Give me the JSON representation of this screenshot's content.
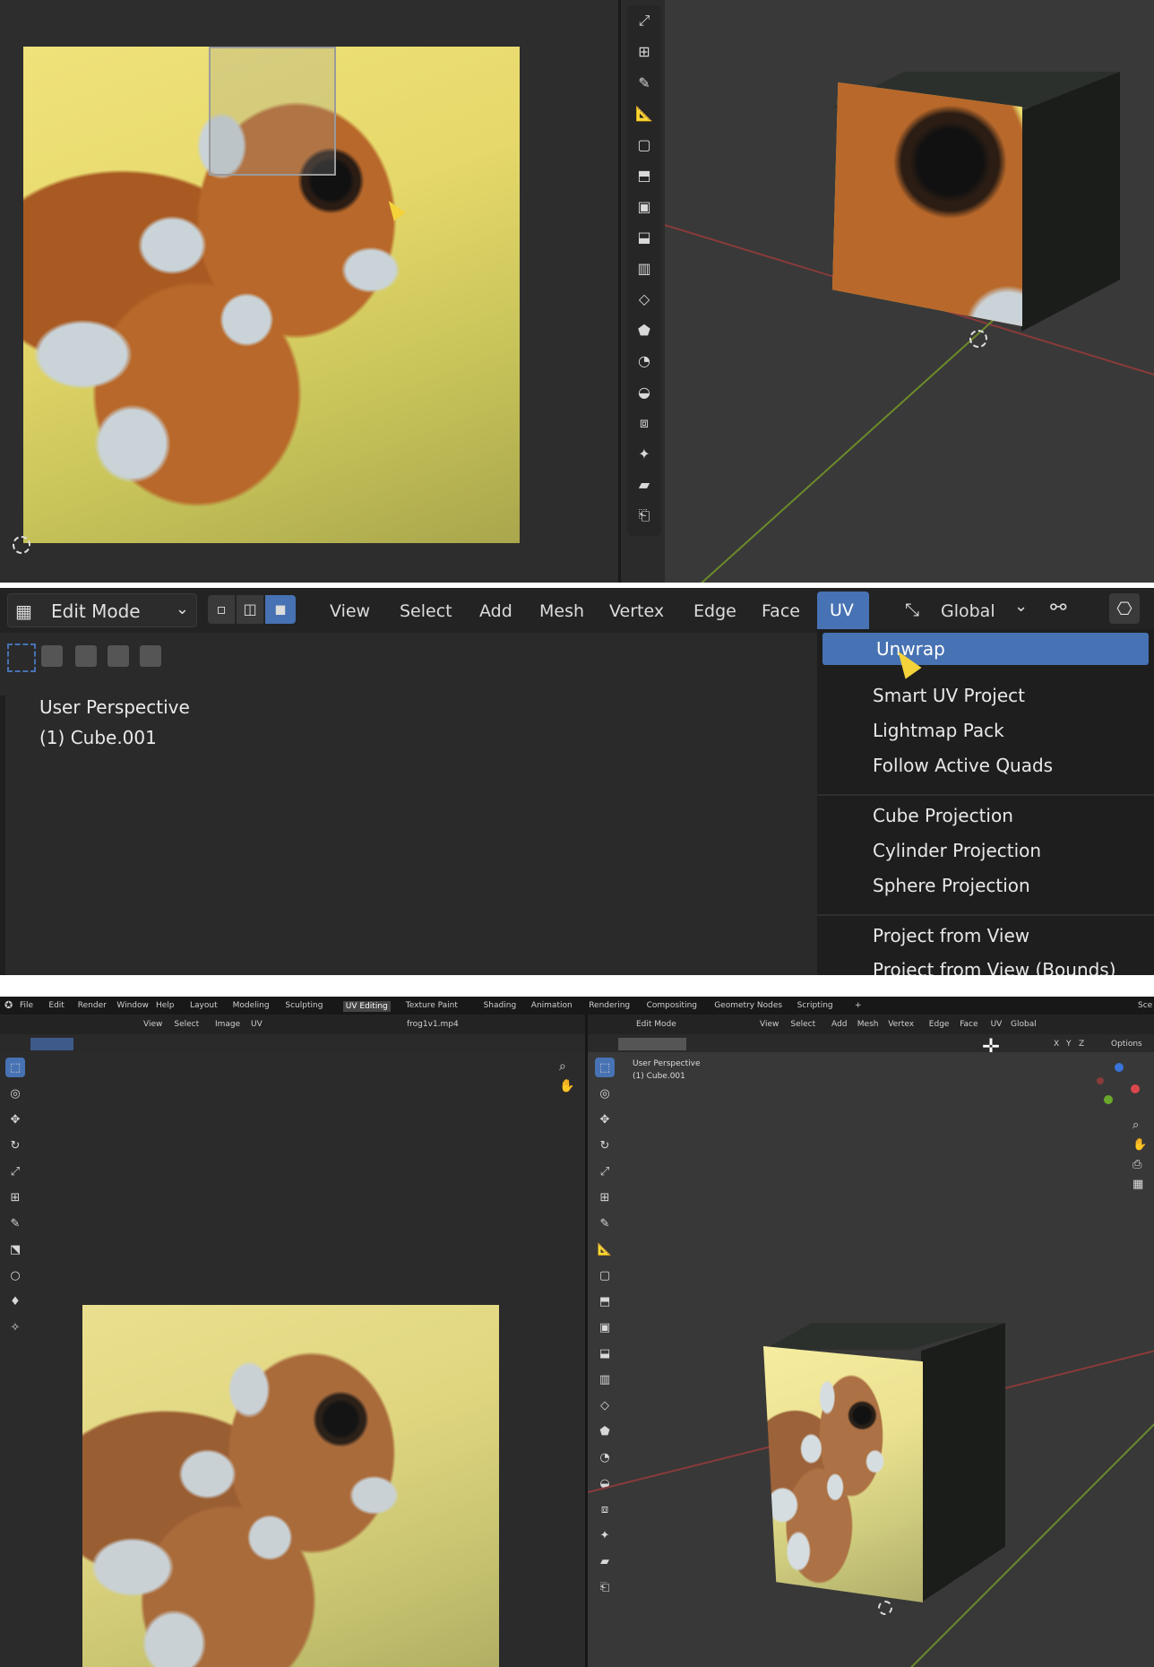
{
  "top": {
    "tools_3d": [
      "scale-icon",
      "transform-icon",
      "annotate-icon",
      "measure-icon",
      "add-cube-icon",
      "extrude-icon",
      "inset-icon",
      "bevel-icon",
      "loop-cut-icon",
      "knife-icon",
      "poly-build-icon",
      "spin-icon",
      "smooth-icon",
      "edge-slide-icon",
      "shrink-icon",
      "shear-icon",
      "rip-icon"
    ]
  },
  "middle": {
    "mode": "Edit Mode",
    "menu": [
      "View",
      "Select",
      "Add",
      "Mesh",
      "Vertex",
      "Edge",
      "Face",
      "UV"
    ],
    "active_menu": "UV",
    "transform_orientation": "Global",
    "viewport_info": {
      "line1": "User Perspective",
      "line2": "(1) Cube.001"
    },
    "uv_menu": {
      "items": [
        "Unwrap",
        "Smart UV Project",
        "Lightmap Pack",
        "Follow Active Quads",
        "Cube Projection",
        "Cylinder Projection",
        "Sphere Projection",
        "Project from View",
        "Project from View (Bounds)"
      ],
      "highlighted": "Unwrap"
    }
  },
  "bottom": {
    "topbar": {
      "menus": [
        "File",
        "Edit",
        "Render",
        "Window",
        "Help"
      ],
      "workspaces": [
        "Layout",
        "Modeling",
        "Sculpting",
        "UV Editing",
        "Texture Paint",
        "Shading",
        "Animation",
        "Rendering",
        "Compositing",
        "Geometry Nodes",
        "Scripting",
        "+"
      ],
      "active_workspace": "UV Editing",
      "scene": "Sce"
    },
    "uv_header": {
      "menus": [
        "View",
        "Select",
        "Image",
        "UV"
      ],
      "image_name": "frog1v1.mp4"
    },
    "vp_header": {
      "mode": "Edit Mode",
      "menus": [
        "View",
        "Select",
        "Add",
        "Mesh",
        "Vertex",
        "Edge",
        "Face",
        "UV"
      ],
      "orientation": "Global",
      "options": "Options",
      "axes": [
        "X",
        "Y",
        "Z"
      ]
    },
    "vp_info": {
      "line1": "User Perspective",
      "line2": "(1) Cube.001"
    },
    "uv_tools": [
      "select-icon",
      "cursor-icon",
      "move-icon",
      "rotate-icon",
      "scale-icon",
      "transform-icon",
      "annotate-icon",
      "rip-region-icon",
      "grab-icon",
      "pinch-icon",
      "relax-icon"
    ],
    "vp_tools": [
      "select-icon",
      "cursor-icon",
      "move-icon",
      "rotate-icon",
      "scale-icon",
      "transform-icon",
      "annotate-icon",
      "measure-icon",
      "add-cube-icon",
      "extrude-icon",
      "inset-icon",
      "bevel-icon",
      "loop-cut-icon",
      "knife-icon",
      "poly-build-icon",
      "spin-icon",
      "smooth-icon",
      "edge-slide-icon",
      "shrink-icon",
      "shear-icon",
      "rip-icon"
    ],
    "colors": {
      "accent": "#4772b3",
      "bg": "#2a2a2a",
      "header": "#1f1f1f"
    }
  }
}
